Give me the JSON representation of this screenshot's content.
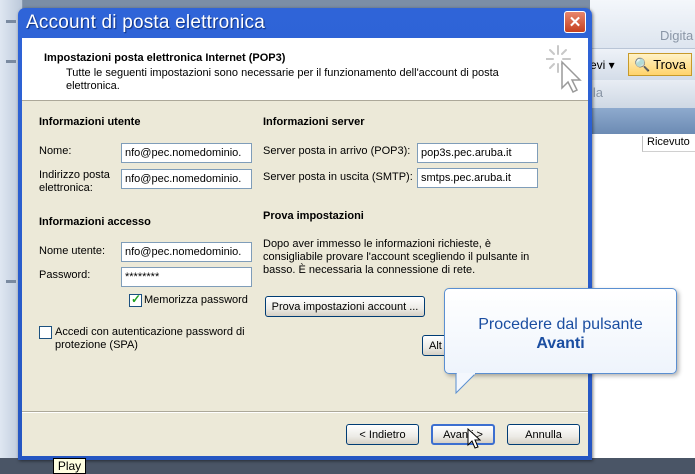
{
  "window": {
    "title": "Account di posta elettronica"
  },
  "header": {
    "title": "Impostazioni posta elettronica Internet (POP3)",
    "description": "Tutte le seguenti impostazioni sono necessarie per il funzionamento dell'account di posta elettronica."
  },
  "user_info": {
    "section_title": "Informazioni utente",
    "name_label": "Nome:",
    "name_value": "nfo@pec.nomedominio.",
    "email_label": "Indirizzo posta elettronica:",
    "email_value": "nfo@pec.nomedominio."
  },
  "access_info": {
    "section_title": "Informazioni accesso",
    "username_label": "Nome utente:",
    "username_value": "nfo@pec.nomedominio.",
    "password_label": "Password:",
    "password_value": "********",
    "remember_label": "Memorizza password",
    "remember_checked": true,
    "spa_label": "Accedi con autenticazione password di protezione (SPA)",
    "spa_checked": false
  },
  "server_info": {
    "section_title": "Informazioni server",
    "incoming_label": "Server posta in arrivo (POP3):",
    "incoming_value": "pop3s.pec.aruba.it",
    "outgoing_label": "Server posta in uscita (SMTP):",
    "outgoing_value": "smtps.pec.aruba.it"
  },
  "test_settings": {
    "section_title": "Prova impostazioni",
    "description": "Dopo aver immesso le informazioni richieste, è consigliabile provare l'account scegliendo il pulsante in basso. È necessaria la connessione di rete.",
    "test_button": "Prova impostazioni account ...",
    "more_button": "Alt"
  },
  "footer": {
    "back_button": "< Indietro",
    "next_button": "Avanti >",
    "cancel_button": "Annulla"
  },
  "callout": {
    "line1": "Procedere dal pulsante",
    "line2": "Avanti"
  },
  "background_app": {
    "brand_fragment": "Digita",
    "nuovi_fragment": "evi",
    "trova_button": "Trova",
    "lla_fragment": "lla",
    "column_ricevuto": "Ricevuto"
  },
  "tooltip": {
    "play": "Play"
  },
  "colors": {
    "title_bar": "#2f64d8",
    "dialog_bg": "#ece9d8",
    "callout_text": "#1b4ea1",
    "close_button": "#c5401f"
  }
}
